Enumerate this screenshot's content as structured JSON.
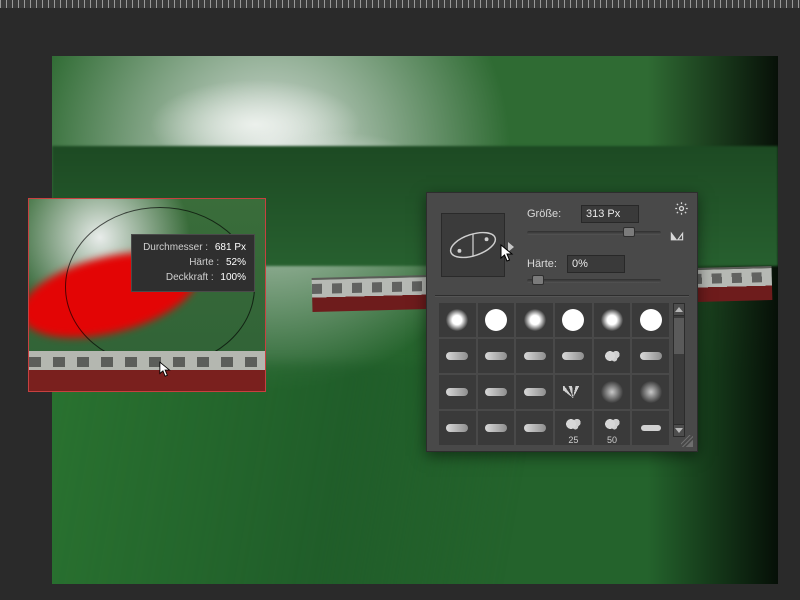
{
  "hud": {
    "diameter_label": "Durchmesser :",
    "diameter_value": "681 Px",
    "hardness_label": "Härte :",
    "hardness_value": "52%",
    "opacity_label": "Deckkraft :",
    "opacity_value": "100%"
  },
  "panel": {
    "size_label": "Größe:",
    "size_value": "313 Px",
    "hardness_label": "Härte:",
    "hardness_value": "0%",
    "swatch_labels": {
      "s25": "25",
      "s50": "50"
    },
    "settings_icon": "gear-icon",
    "flip_icon": "flip-x-icon"
  }
}
